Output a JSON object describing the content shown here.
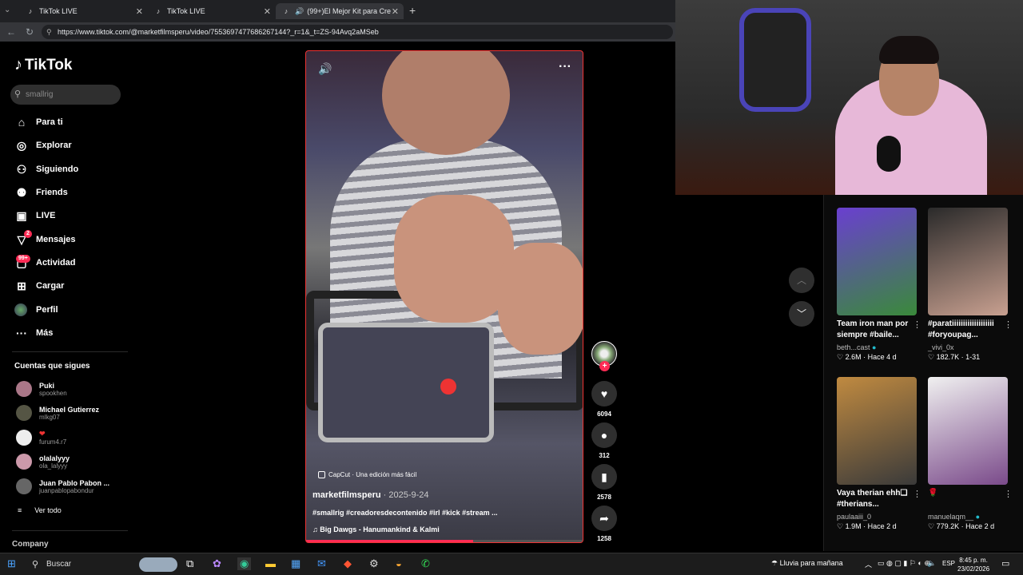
{
  "browser": {
    "tabs": [
      {
        "title": "TikTok LIVE",
        "icon": "tiktok-icon"
      },
      {
        "title": "TikTok LIVE",
        "icon": "tiktok-icon"
      },
      {
        "title": "(99+)El Mejor Kit para Crear C",
        "icon": "tiktok-icon",
        "active": true
      }
    ],
    "url": "https://www.tiktok.com/@marketfilmsperu/video/7553697477686267144?_r=1&_t=ZS-94Avq2aMSeb"
  },
  "sidebar": {
    "logo": "TikTok",
    "search_placeholder": "smallrig",
    "nav": [
      {
        "label": "Para ti",
        "icon": "home-icon"
      },
      {
        "label": "Explorar",
        "icon": "compass-icon"
      },
      {
        "label": "Siguiendo",
        "icon": "following-icon"
      },
      {
        "label": "Friends",
        "icon": "friends-icon"
      },
      {
        "label": "LIVE",
        "icon": "live-icon"
      },
      {
        "label": "Mensajes",
        "icon": "messages-icon",
        "badge": "2"
      },
      {
        "label": "Actividad",
        "icon": "activity-icon",
        "badge": "99+"
      },
      {
        "label": "Cargar",
        "icon": "upload-icon"
      },
      {
        "label": "Perfil",
        "icon": "profile-icon"
      },
      {
        "label": "Más",
        "icon": "more-icon"
      }
    ],
    "following_title": "Cuentas que sigues",
    "accounts": [
      {
        "name": "Puki",
        "handle": "spookhen"
      },
      {
        "name": "Michael Gutierrez",
        "handle": "mlkg07"
      },
      {
        "name": "",
        "handle": "furum4.r7"
      },
      {
        "name": "olalalyyy",
        "handle": "ola_lalyyy"
      },
      {
        "name": "Juan Pablo Pabon ...",
        "handle": "juanpablopabondur"
      }
    ],
    "see_all": "Ver todo",
    "company": "Company"
  },
  "video": {
    "capcut": "CapCut · Una edición más fácil",
    "author": "marketfilmsperu",
    "date": "· 2025-9-24",
    "caption": "#smallrig #creadoresdecontenido #irl #kick #stream ...",
    "music": "Big Dawgs - Hanumankind & Kalmi",
    "progress": 0.6
  },
  "actions": {
    "likes": "6094",
    "comments": "312",
    "saves": "2578",
    "shares": "1258"
  },
  "recommendations": [
    {
      "title": "Team iron man por siempre #baile...",
      "author": "beth...cast",
      "likes": "2.6M",
      "time": "Hace 4 d",
      "color1": "#6a3fd0",
      "color2": "#3a8a3a"
    },
    {
      "title": "#paratiiiiiiiiiiiiiiiiiii #foryoupag...",
      "author": "_vivi_0x",
      "likes": "182.7K",
      "time": "1-31",
      "color1": "#2a2a2a",
      "color2": "#c8a090"
    },
    {
      "title": "Vaya therian ehh❑ #therians...",
      "author": "paulaaiii_0",
      "likes": "1.9M",
      "time": "Hace 2 d",
      "color1": "#c08a40",
      "color2": "#3a3a3a"
    },
    {
      "title": "",
      "author": "manuelaqm__",
      "likes": "779.2K",
      "time": "Hace 2 d",
      "color1": "#f0f0f0",
      "color2": "#7a4a8a"
    }
  ],
  "taskbar": {
    "search": "Buscar",
    "weather": "Lluvia para mañana",
    "lang": "ESP",
    "time": "8:45 p. m.",
    "date": "23/02/2026"
  }
}
